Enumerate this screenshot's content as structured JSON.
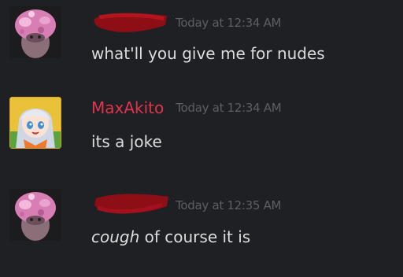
{
  "messages": [
    {
      "avatar_icon": "pink-blob-avatar-icon",
      "username_redacted": true,
      "username_color": "#a0121a",
      "timestamp": "Today at 12:34 AM",
      "text": "what'll you give me for nudes"
    },
    {
      "avatar_icon": "anime-girl-avatar-icon",
      "username": "MaxAkito",
      "username_color": "#e0334c",
      "timestamp": "Today at 12:34 AM",
      "text": "its a joke"
    },
    {
      "avatar_icon": "pink-blob-avatar-icon",
      "username_redacted": true,
      "username_color": "#a0121a",
      "timestamp": "Today at 12:35 AM",
      "text_emphasis": "cough",
      "text": " of course it is"
    }
  ],
  "colors": {
    "background": "#1f2023",
    "message_text": "#dcdddf",
    "timestamp": "#5c5e63"
  }
}
